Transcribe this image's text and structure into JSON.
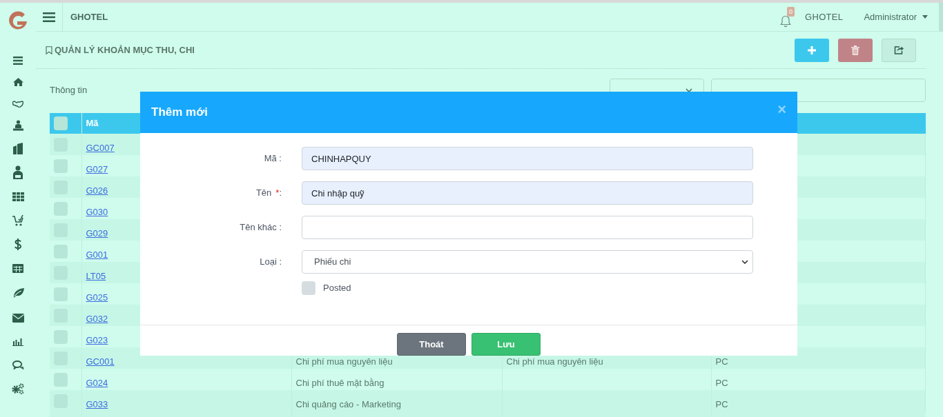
{
  "header": {
    "app_name": "GHOTEL",
    "notification_count": "0",
    "hotel": "GHOTEL",
    "user": "Administrator"
  },
  "page_title": "QUẢN LÝ KHOẢN MỤC THU, CHI",
  "section_title": "Thông tin",
  "table": {
    "header_checked": false,
    "columns": [
      "Mã"
    ],
    "rows": [
      {
        "code": "GC007",
        "checked": false
      },
      {
        "code": "G027",
        "checked": false
      },
      {
        "code": "G026",
        "checked": false
      },
      {
        "code": "G030",
        "checked": false
      },
      {
        "code": "G029",
        "checked": false
      },
      {
        "code": "G001",
        "checked": false
      },
      {
        "code": "LT05",
        "checked": false
      },
      {
        "code": "G025",
        "checked": false
      },
      {
        "code": "G032",
        "checked": false
      },
      {
        "code": "G023",
        "checked": false
      },
      {
        "code": "GC001",
        "checked": false,
        "column_3": "Chi phí mua nguyên liệu",
        "column_4": "Chi phí mua nguyên liệu",
        "column_5": "PC"
      },
      {
        "code": "G024",
        "checked": false,
        "column_3": "Chi phí thuê mặt bằng",
        "column_5": "PC"
      },
      {
        "code": "G033",
        "checked": false,
        "column_3": "Chi quảng cáo - Marketing",
        "column_5": "PC"
      }
    ]
  },
  "modal": {
    "title": "Thêm mới",
    "close": "×",
    "fields": [
      {
        "kind": "text",
        "label": "Mã :",
        "required": false,
        "value": "CHINHAPQUY",
        "autofilled": true
      },
      {
        "kind": "text",
        "label": "Tên",
        "required": true,
        "required_mark": "*",
        "suffix": ":",
        "value": "Chi nhập quỹ",
        "autofilled": true
      },
      {
        "kind": "text",
        "label": "Tên khác :",
        "required": false,
        "autofilled": false
      },
      {
        "kind": "select",
        "label": "Loại :",
        "required": false,
        "value": "Phiếu chi",
        "autofilled": false
      },
      {
        "kind": "checkbox",
        "label": "Posted",
        "checked": false
      }
    ],
    "buttons": [
      {
        "kind": "secondary",
        "label": "Thoát"
      },
      {
        "kind": "primary",
        "label": "Lưu"
      }
    ]
  }
}
